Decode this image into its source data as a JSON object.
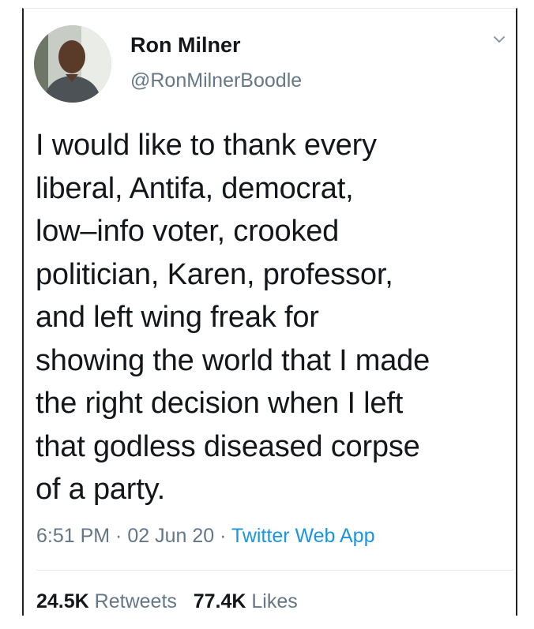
{
  "tweet": {
    "author": {
      "name": "Ron Milner",
      "handle": "@RonMilnerBoodle"
    },
    "text_lines": [
      "I would like to thank every",
      "liberal, Antifa, democrat,",
      "low–info voter, crooked",
      "politician, Karen, professor,",
      "and left wing freak for",
      "showing the world that I made",
      "the right decision when I left",
      "that godless diseased corpse",
      "of a party."
    ],
    "time": "6:51 PM",
    "date": "02 Jun 20",
    "separator": " · ",
    "source": "Twitter Web App",
    "stats": {
      "retweets_count": "24.5K",
      "retweets_label": "Retweets",
      "likes_count": "77.4K",
      "likes_label": "Likes"
    }
  },
  "icons": {
    "menu": "chevron-down-icon",
    "avatar": "avatar"
  },
  "colors": {
    "text": "#14171a",
    "secondary": "#657786",
    "link": "#1b95e0",
    "divider": "#e6ecf0"
  }
}
